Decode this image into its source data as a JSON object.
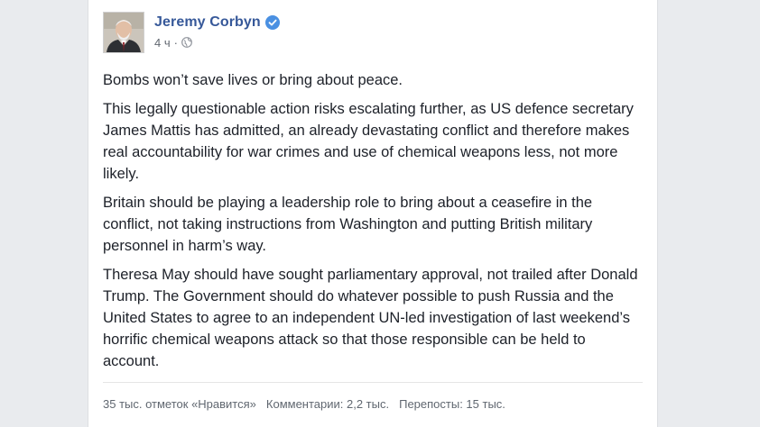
{
  "post": {
    "author": "Jeremy Corbyn",
    "time": "4 ч",
    "separator": "·",
    "paragraphs": [
      "Bombs won’t save lives or bring about peace.",
      "This legally questionable action risks escalating further, as US defence secretary James Mattis has admitted, an already devastating conflict and therefore makes real accountability for war crimes and use of chemical weapons less, not more likely.",
      "Britain should be playing a leadership role to bring about a ceasefire in the conflict, not taking instructions from Washington and putting British military personnel in harm’s way.",
      "Theresa May should have sought parliamentary approval, not trailed after Donald Trump. The Government should do whatever possible to push Russia and the United States to agree to an independent UN-led investigation of last weekend’s horrific chemical weapons attack so that those responsible can be held to account."
    ],
    "stats": {
      "likes": "35 тыс. отметок «Нравится»",
      "comments": "Комментарии: 2,2 тыс.",
      "shares": "Перепосты: 15 тыс."
    }
  },
  "icons": {
    "verified": "verified-badge-icon",
    "audience": "globe-icon"
  },
  "colors": {
    "author_link": "#365899",
    "verified": "#4a90e2",
    "text": "#1d2129",
    "meta": "#616770",
    "background": "#e9ebee"
  }
}
